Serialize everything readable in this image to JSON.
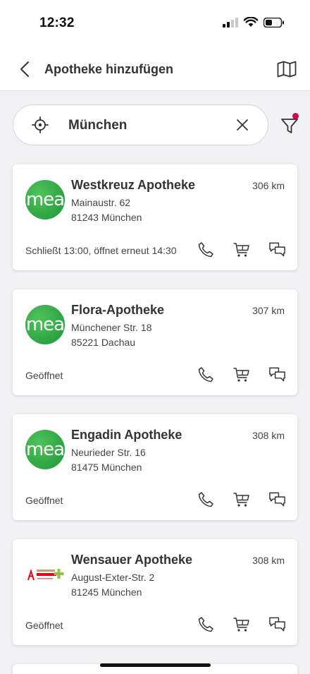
{
  "status_bar": {
    "time": "12:32"
  },
  "header": {
    "title": "Apotheke hinzufügen"
  },
  "search": {
    "value": "München"
  },
  "pharmacies": [
    {
      "name": "Westkreuz Apotheke",
      "distance": "306 km",
      "street": "Mainaustr. 62",
      "city": "81243 München",
      "status": "Schließt 13:00, öffnet erneut 14:30",
      "logo": "mea"
    },
    {
      "name": "Flora-Apotheke",
      "distance": "307 km",
      "street": "Münchener Str. 18",
      "city": "85221 Dachau",
      "status": "Geöffnet",
      "logo": "mea"
    },
    {
      "name": "Engadin Apotheke",
      "distance": "308 km",
      "street": "Neurieder Str. 16",
      "city": "81475 München",
      "status": "Geöffnet",
      "logo": "mea"
    },
    {
      "name": "Wensauer Apotheke",
      "distance": "308 km",
      "street": "August-Exter-Str. 2",
      "city": "81245 München",
      "status": "Geöffnet",
      "logo": "linden"
    }
  ],
  "logo_text": {
    "mea": "mea"
  },
  "colors": {
    "accent": "#d6004f",
    "mea_green": "#2fa644",
    "apotheke_red": "#e3001b"
  }
}
